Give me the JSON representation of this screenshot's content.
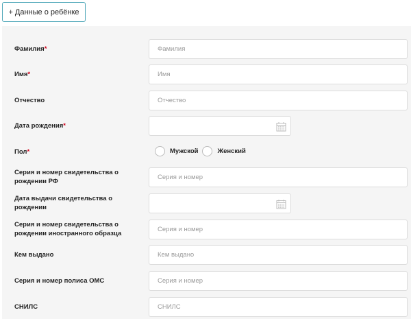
{
  "add_child_button": "+ Данные о ребёнке",
  "fields": {
    "surname": {
      "label": "Фамилия",
      "required": "*",
      "placeholder": "Фамилия"
    },
    "name": {
      "label": "Имя",
      "required": "*",
      "placeholder": "Имя"
    },
    "patronymic": {
      "label": "Отчество",
      "placeholder": "Отчество"
    },
    "birth_date": {
      "label": "Дата рождения",
      "required": "*"
    },
    "gender": {
      "label": "Пол",
      "required": "*",
      "options": [
        "Мужской",
        "Женский"
      ]
    },
    "birth_cert": {
      "label_line1": "Серия и номер свидетельства о",
      "label_line2": "рождении РФ",
      "placeholder": "Серия и номер"
    },
    "cert_issue_date": {
      "label_line1": "Дата выдачи свидетельства о",
      "label_line2": "рождении"
    },
    "foreign_cert": {
      "label_line1": "Серия и номер свидетельства о",
      "label_line2": "рождении иностранного образца",
      "placeholder": "Серия и номер"
    },
    "issued_by": {
      "label": "Кем выдано",
      "placeholder": "Кем выдано"
    },
    "oms_policy": {
      "label": "Серия и номер полиса ОМС",
      "placeholder": "Серия и номер"
    },
    "snils": {
      "label": "СНИЛС",
      "placeholder": "СНИЛС"
    }
  },
  "icons": {
    "calendar": "calendar-icon"
  },
  "colors": {
    "accent_border": "#4fa7b9",
    "required": "#d0021b",
    "panel_bg": "#f5f5f5"
  }
}
